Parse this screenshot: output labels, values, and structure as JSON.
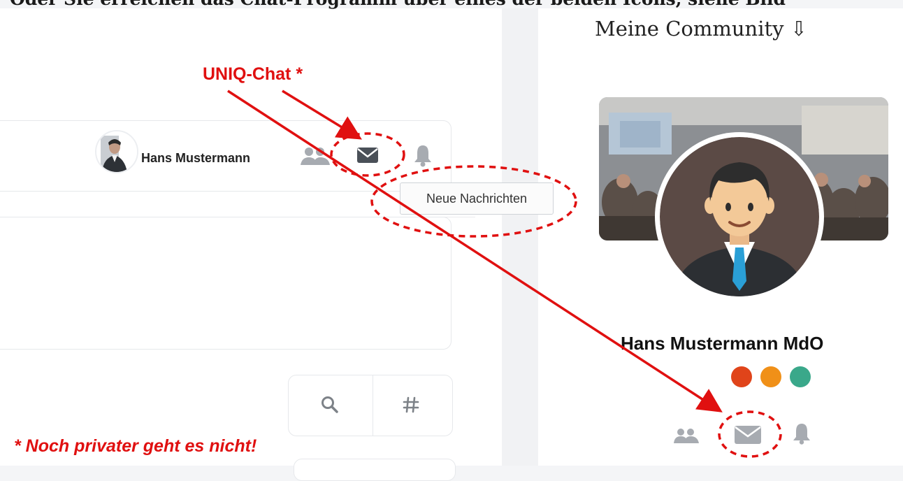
{
  "caption": "Oder Sie erreichen das Chat-Programm über eines der beiden Icons, siehe Bild",
  "community": {
    "title": "Meine Community ⇩",
    "profile_name": "Hans Mustermann MdO"
  },
  "user_bar": {
    "name": "Hans Mustermann",
    "tooltip": "Neue Nachrichten"
  },
  "annotations": {
    "uniq_chat": "UNIQ-Chat *",
    "note": "* Noch privater geht es nicht!"
  },
  "colors": {
    "annotation_red": "#e01010",
    "icon_gray": "#a7abb1",
    "icon_dark": "#4a5058"
  },
  "icons": [
    "contacts-icon",
    "envelope-icon",
    "bell-icon",
    "search-icon",
    "hashtag-icon"
  ]
}
